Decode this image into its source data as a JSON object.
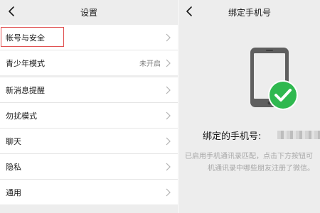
{
  "settings": {
    "title": "设置",
    "groups": [
      [
        {
          "label": "帐号与安全",
          "value": ""
        },
        {
          "label": "青少年模式",
          "value": "未开启"
        }
      ],
      [
        {
          "label": "新消息提醒",
          "value": ""
        },
        {
          "label": "勿扰模式",
          "value": ""
        },
        {
          "label": "聊天",
          "value": ""
        },
        {
          "label": "隐私",
          "value": ""
        },
        {
          "label": "通用",
          "value": ""
        }
      ]
    ]
  },
  "bind_phone": {
    "title": "绑定手机号",
    "bound_label": "绑定的手机号:",
    "description_line1": "已启用手机通讯录匹配，点击下方按钮可",
    "description_line2": "机通讯录中哪些朋友注册了微信。",
    "check_color": "#2fb84f",
    "phone_color": "#5f5f5f"
  },
  "colors": {
    "background": "#ededed",
    "card": "#ffffff",
    "highlight_border": "#e05252"
  }
}
